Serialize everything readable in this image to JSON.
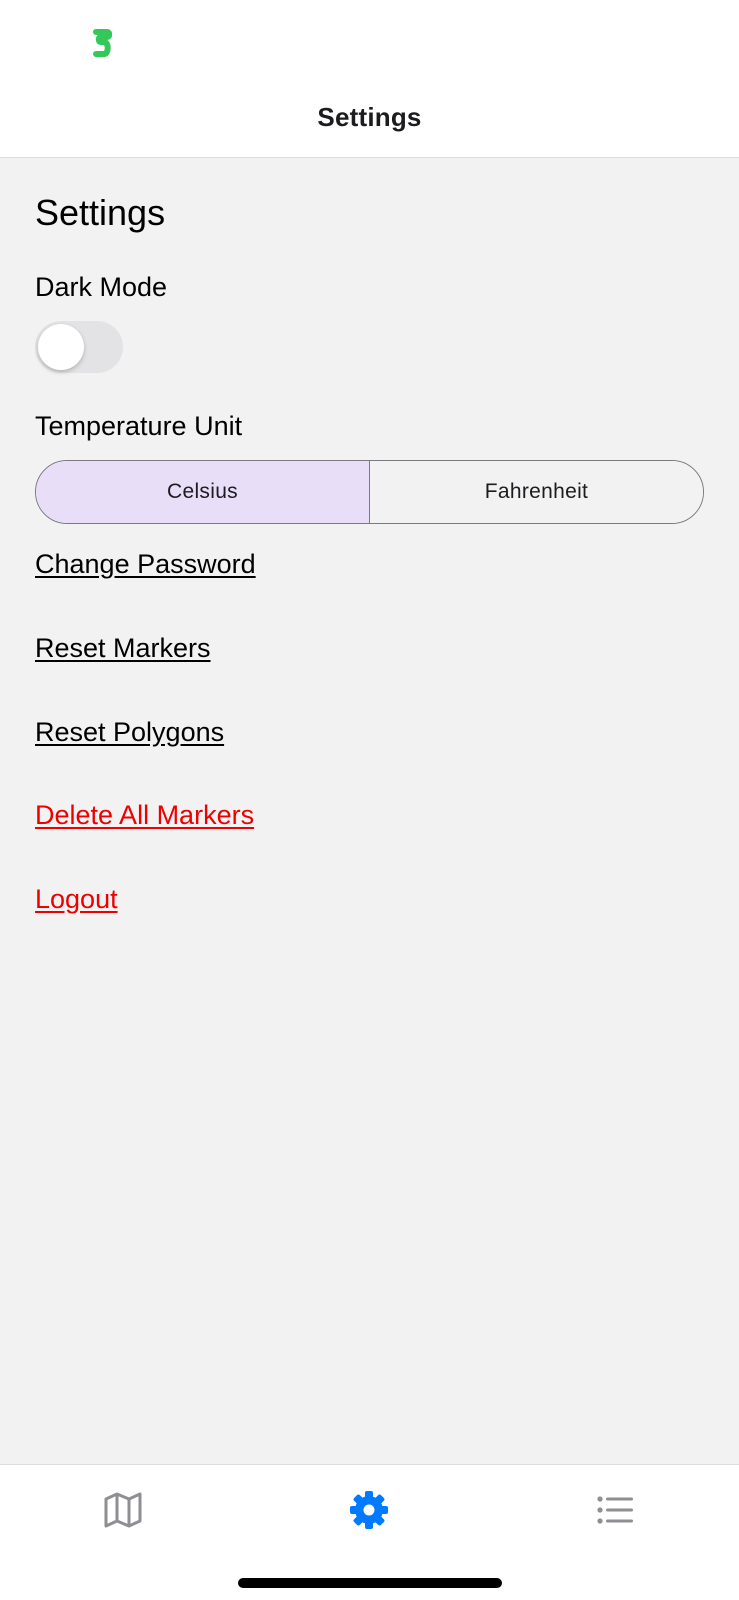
{
  "header": {
    "title": "Settings"
  },
  "main": {
    "section_title": "Settings",
    "dark_mode": {
      "label": "Dark Mode",
      "enabled": false
    },
    "temperature": {
      "label": "Temperature Unit",
      "options": [
        "Celsius",
        "Fahrenheit"
      ],
      "selected": "Celsius"
    },
    "links": {
      "change_password": "Change Password",
      "reset_markers": "Reset Markers",
      "reset_polygons": "Reset Polygons",
      "delete_all_markers": "Delete All Markers",
      "logout": "Logout"
    }
  },
  "tab_bar": {
    "tabs": [
      {
        "icon": "map-icon",
        "active": false
      },
      {
        "icon": "gear-icon",
        "active": true
      },
      {
        "icon": "list-icon",
        "active": false
      }
    ]
  },
  "colors": {
    "active_tab": "#007aff",
    "inactive_tab": "#8e8e93",
    "segment_selected": "#e8def8",
    "danger": "#ee0000",
    "toggle_off": "#e3e3e6",
    "status_app_icon": "#34c759"
  }
}
